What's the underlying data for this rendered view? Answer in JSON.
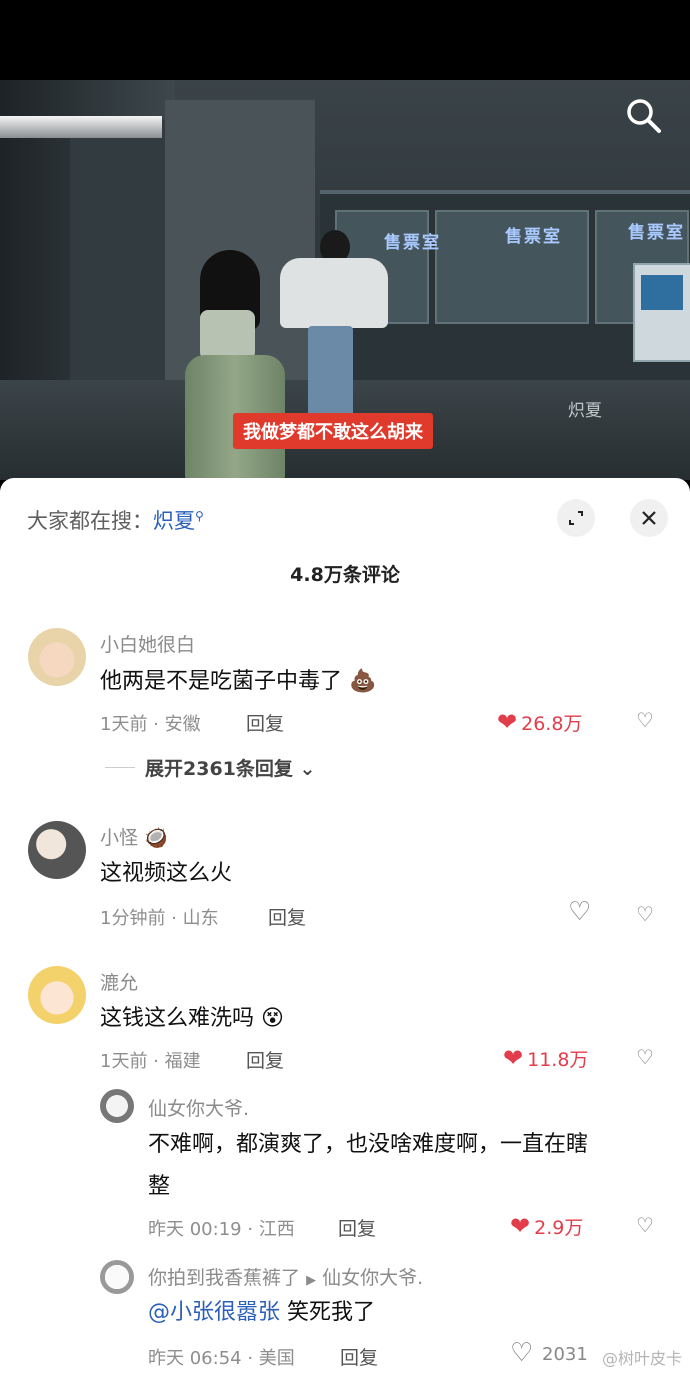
{
  "video": {
    "subtitle": "我做梦都不敢这么胡来",
    "signs": [
      "售票室",
      "售票室",
      "售票室"
    ],
    "watermark": "炽夏"
  },
  "panel": {
    "search_prefix": "大家都在搜：",
    "search_term": "炽夏",
    "comment_count": "4.8万条评论"
  },
  "comments": [
    {
      "user": "小白她很白",
      "text": "他两是不是吃菌子中毒了",
      "meta": "1天前 · 安徽",
      "reply_label": "回复",
      "likes": "26.8万",
      "liked": true,
      "expand": "展开2361条回复"
    },
    {
      "user": "小怪",
      "text": "这视频这么火",
      "meta": "1分钟前 · 山东",
      "reply_label": "回复",
      "likes": "",
      "liked": false
    },
    {
      "user": "漉允",
      "text": "这钱这么难洗吗",
      "meta": "1天前 · 福建",
      "reply_label": "回复",
      "likes": "11.8万",
      "liked": true
    }
  ],
  "replies": [
    {
      "user": "仙女你大爷.",
      "text_line1": "不难啊，都演爽了，也没啥难度啊，一直在瞎",
      "text_line2": "整",
      "meta": "昨天 00:19 · 江西",
      "reply_label": "回复",
      "likes": "2.9万",
      "liked": true
    },
    {
      "user": "你拍到我香蕉裤了",
      "reply_to": "仙女你大爷.",
      "mention": "@小张很嚣张",
      "text": " 笑死我了",
      "meta": "昨天 06:54 · 美国",
      "reply_label": "回复",
      "likes": "2031"
    }
  ],
  "footer_watermark": "@树叶皮卡",
  "colors": {
    "like": "#e23d4a",
    "link": "#2b5fba",
    "subtitle_bg": "#e03a2c"
  }
}
